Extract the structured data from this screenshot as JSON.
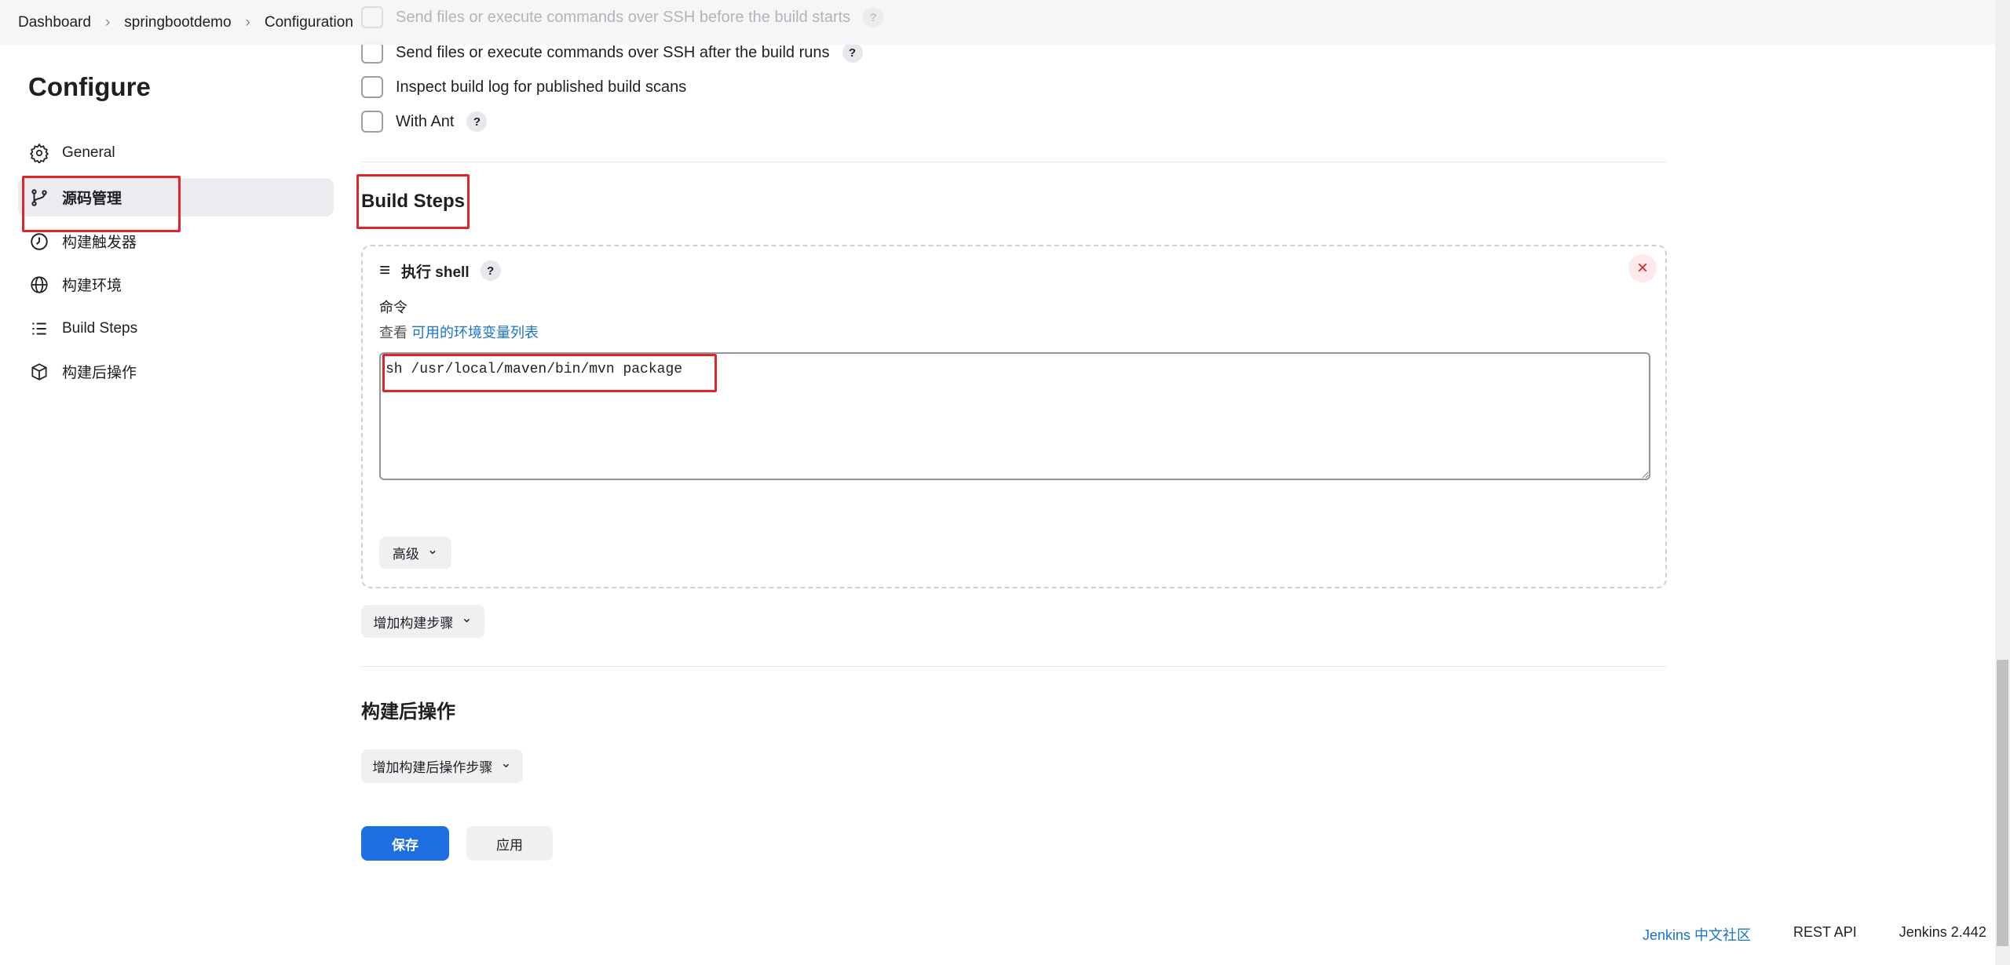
{
  "breadcrumb": [
    "Dashboard",
    "springbootdemo",
    "Configuration"
  ],
  "faded_option": "Send files or execute commands over SSH before the build starts",
  "page_title": "Configure",
  "sidebar": {
    "items": [
      {
        "label": "General",
        "icon": "gear-icon"
      },
      {
        "label": "源码管理",
        "icon": "git-branch-icon",
        "active": true
      },
      {
        "label": "构建触发器",
        "icon": "clock-icon"
      },
      {
        "label": "构建环境",
        "icon": "globe-icon"
      },
      {
        "label": "Build Steps",
        "icon": "list-icon"
      },
      {
        "label": "构建后操作",
        "icon": "package-icon"
      }
    ]
  },
  "options": [
    {
      "label": "Send files or execute commands over SSH after the build runs",
      "help": true,
      "checked": false
    },
    {
      "label": "Inspect build log for published build scans",
      "help": false,
      "checked": false
    },
    {
      "label": "With Ant",
      "help": true,
      "checked": false
    }
  ],
  "build_steps": {
    "heading": "Build Steps",
    "step": {
      "title": "执行 shell",
      "command_label": "命令",
      "env_prefix": "查看",
      "env_link": "可用的环境变量列表",
      "command": "sh /usr/local/maven/bin/mvn package",
      "advanced": "高级"
    },
    "add_step": "增加构建步骤"
  },
  "post_build": {
    "heading": "构建后操作",
    "add_step": "增加构建后操作步骤"
  },
  "actions": {
    "save": "保存",
    "apply": "应用"
  },
  "footer": {
    "community": "Jenkins 中文社区",
    "rest_api": "REST API",
    "version": "Jenkins 2.442"
  },
  "colors": {
    "primary": "#1d6ee0",
    "highlight": "#e0262a",
    "link": "#1a73c8"
  },
  "help_glyph": "?",
  "close_glyph": "×",
  "chevron": "⌄"
}
